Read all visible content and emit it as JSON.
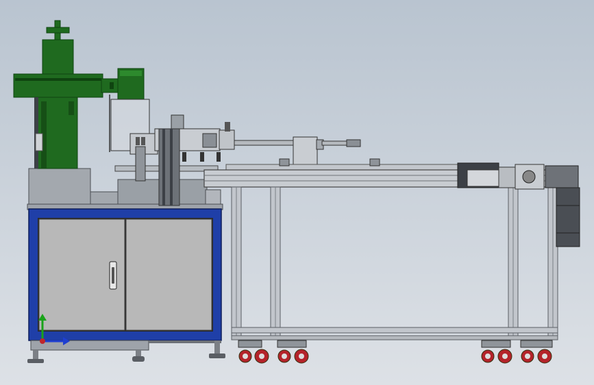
{
  "view": {
    "background_top": "#b9c4d0",
    "background_bottom": "#dde1e6"
  },
  "colors": {
    "cabinet_blue": "#1f3fa8",
    "cabinet_door": "#b8b8b8",
    "green_machine": "#1f6a1f",
    "green_dark": "#0f4410",
    "frame_aluminum": "#c2c6cc",
    "frame_dark": "#5a5e64",
    "caster_red": "#b4232a",
    "axis_y": "#1aa31a",
    "axis_x": "#1f3fd0"
  },
  "icons": {
    "triad": "coordinate-axis-triad-icon",
    "door_handle": "door-handle-icon"
  }
}
